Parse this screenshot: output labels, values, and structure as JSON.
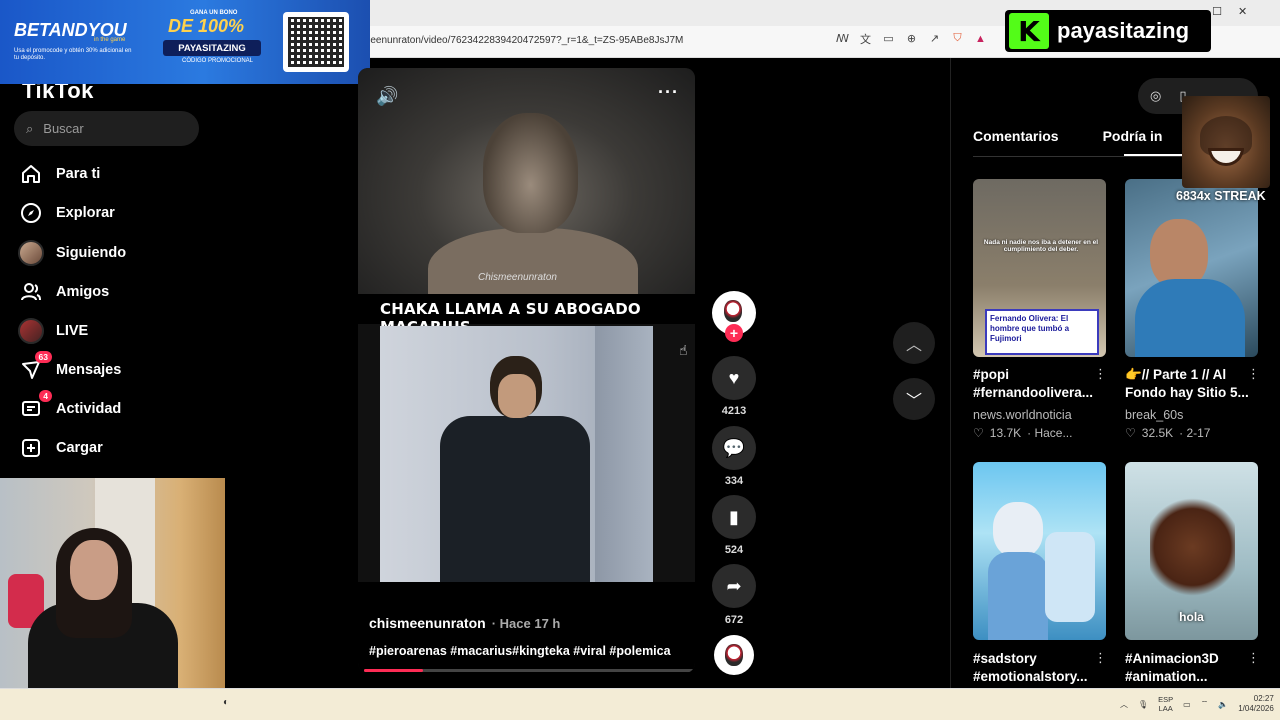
{
  "browser": {
    "url": "meenunraton/video/7623422839420472597?_r=1&_t=ZS-95ABe8JsJ7M",
    "window_controls": [
      "–",
      "☐",
      "✕"
    ]
  },
  "ad": {
    "brand": "BETANDYOU",
    "brand_sub": "in the game",
    "note": "Usa el promocode y obtén 30% adicional en tu depósito.",
    "gana": "GANA UN BONO",
    "bono": "DE 100%",
    "code": "PAYASITAZING",
    "promo": "CÓDIGO PROMOCIONAL"
  },
  "nav": {
    "logo": "TikTok",
    "search_placeholder": "Buscar",
    "items": [
      {
        "label": "Para ti",
        "icon": "home-icon"
      },
      {
        "label": "Explorar",
        "icon": "compass-icon"
      },
      {
        "label": "Siguiendo",
        "icon": "following-avatar"
      },
      {
        "label": "Amigos",
        "icon": "friends-icon"
      },
      {
        "label": "LIVE",
        "icon": "live-avatar"
      },
      {
        "label": "Mensajes",
        "icon": "messages-icon",
        "badge": "63"
      },
      {
        "label": "Actividad",
        "icon": "activity-icon",
        "badge": "4"
      },
      {
        "label": "Cargar",
        "icon": "upload-icon"
      }
    ]
  },
  "video": {
    "title": "CHAKA LLAMA A SU ABOGADO MACARIUS",
    "watermark": "Chismeenunraton",
    "author": "chismeenunraton",
    "time": "· Hace 17 h",
    "hashtags": "#pieroarenas #macarius#kingteka #viral #polemica",
    "progress": 0.18
  },
  "rail": {
    "likes": "4213",
    "comments": "334",
    "saves": "524",
    "shares": "672"
  },
  "tabs": [
    "Comentarios",
    "Podría in"
  ],
  "cards": [
    {
      "title": "#popi #fernandoolivera...",
      "user": "news.worldnoticia",
      "likes": "13.7K",
      "date": "· Hace...",
      "overlay": "Nada ni nadie nos iba a detener en el cumplimiento del deber.",
      "caption": "Fernando Olivera: El hombre que tumbó a Fujimori"
    },
    {
      "title": "👉// Parte 1 // Al Fondo hay Sitio 5...",
      "user": "break_60s",
      "likes": "32.5K",
      "date": "· 2-17"
    },
    {
      "title": "#sadstory #emotionalstory...",
      "user": "",
      "likes": "",
      "date": ""
    },
    {
      "title": "#Animacion3D #animation...",
      "user": "",
      "likes": "",
      "date": "",
      "overlay": "hola"
    }
  ],
  "overlay": {
    "kick_name": "payasitazing",
    "kick_logo": "K",
    "streak": "6834x STREAK"
  },
  "taskbar": {
    "lang1": "ESP",
    "lang2": "LAA",
    "time": "02:27",
    "date": "1/04/2026"
  }
}
